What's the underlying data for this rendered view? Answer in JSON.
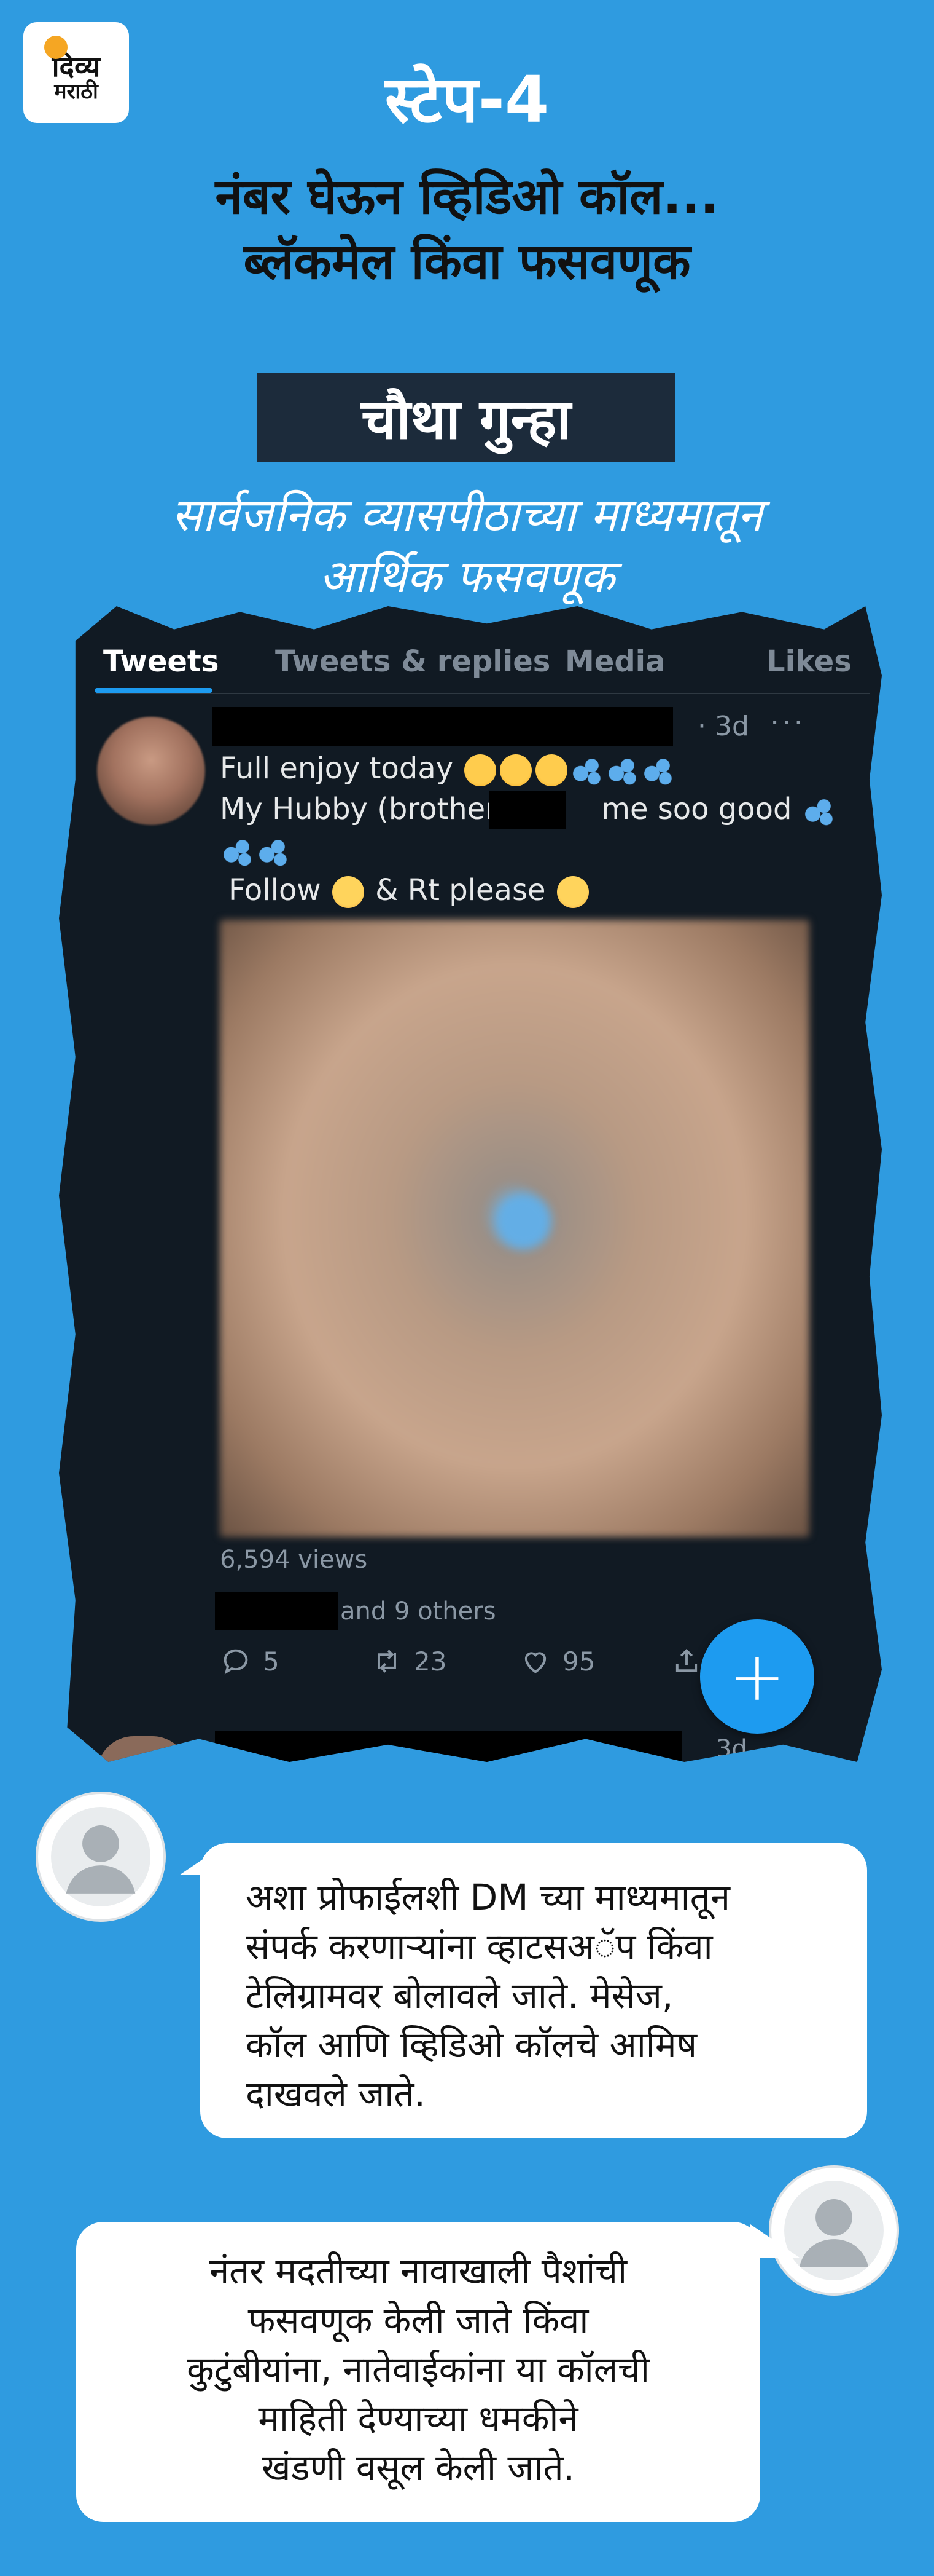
{
  "logo": {
    "line1": "दिव्य",
    "line2": "मराठी"
  },
  "header": {
    "step": "स्टेप-4",
    "heading_line1": "नंबर घेऊन व्हिडिओ कॉल...",
    "heading_line2": "ब्लॅकमेल किंवा फसवणूक"
  },
  "crime_label": "चौथा गुन्हा",
  "subtitle_line1": "सार्वजनिक व्यासपीठाच्या माध्यमातून",
  "subtitle_line2": "आर्थिक फसवणूक",
  "tabs": [
    {
      "label": "Tweets"
    },
    {
      "label": "Tweets & replies"
    },
    {
      "label": "Media"
    },
    {
      "label": "Likes"
    }
  ],
  "tweet": {
    "time": "· 3d",
    "more": "···",
    "line1": "Full enjoy today",
    "line2a": "My Hubby (brother)",
    "line2b": "me soo good",
    "line3a": "Follow",
    "line3b": "& Rt please",
    "views": "6,594 views",
    "liked_by": "and 9 others",
    "replies": "5",
    "retweets": "23",
    "likes": "95",
    "fab_plus": "+",
    "next_time": "3d"
  },
  "bubble1": [
    "अशा प्रोफाईलशी DM च्या माध्यमातून",
    "संपर्क करणाऱ्यांना व्हाटसअॅप किंवा",
    "टेलिग्रामवर बोलावले जाते. मेसेज,",
    "कॉल आणि व्हिडिओ कॉलचे आमिष",
    "दाखवले जाते."
  ],
  "bubble2": [
    "नंतर मदतीच्या नावाखाली पैशांची",
    "फसवणूक केली जाते किंवा",
    "कुटुंबीयांना, नातेवाईकांना या कॉलची",
    "माहिती देण्याच्या धमकीने",
    "खंडणी वसूल केली जाते."
  ],
  "colors": {
    "background": "#2f9be0",
    "panel": "#111a23",
    "accent": "#1d9bf0",
    "label_box": "#1c2b3b"
  },
  "icons": [
    "reply-icon",
    "retweet-icon",
    "like-icon",
    "share-icon",
    "person-icon"
  ]
}
